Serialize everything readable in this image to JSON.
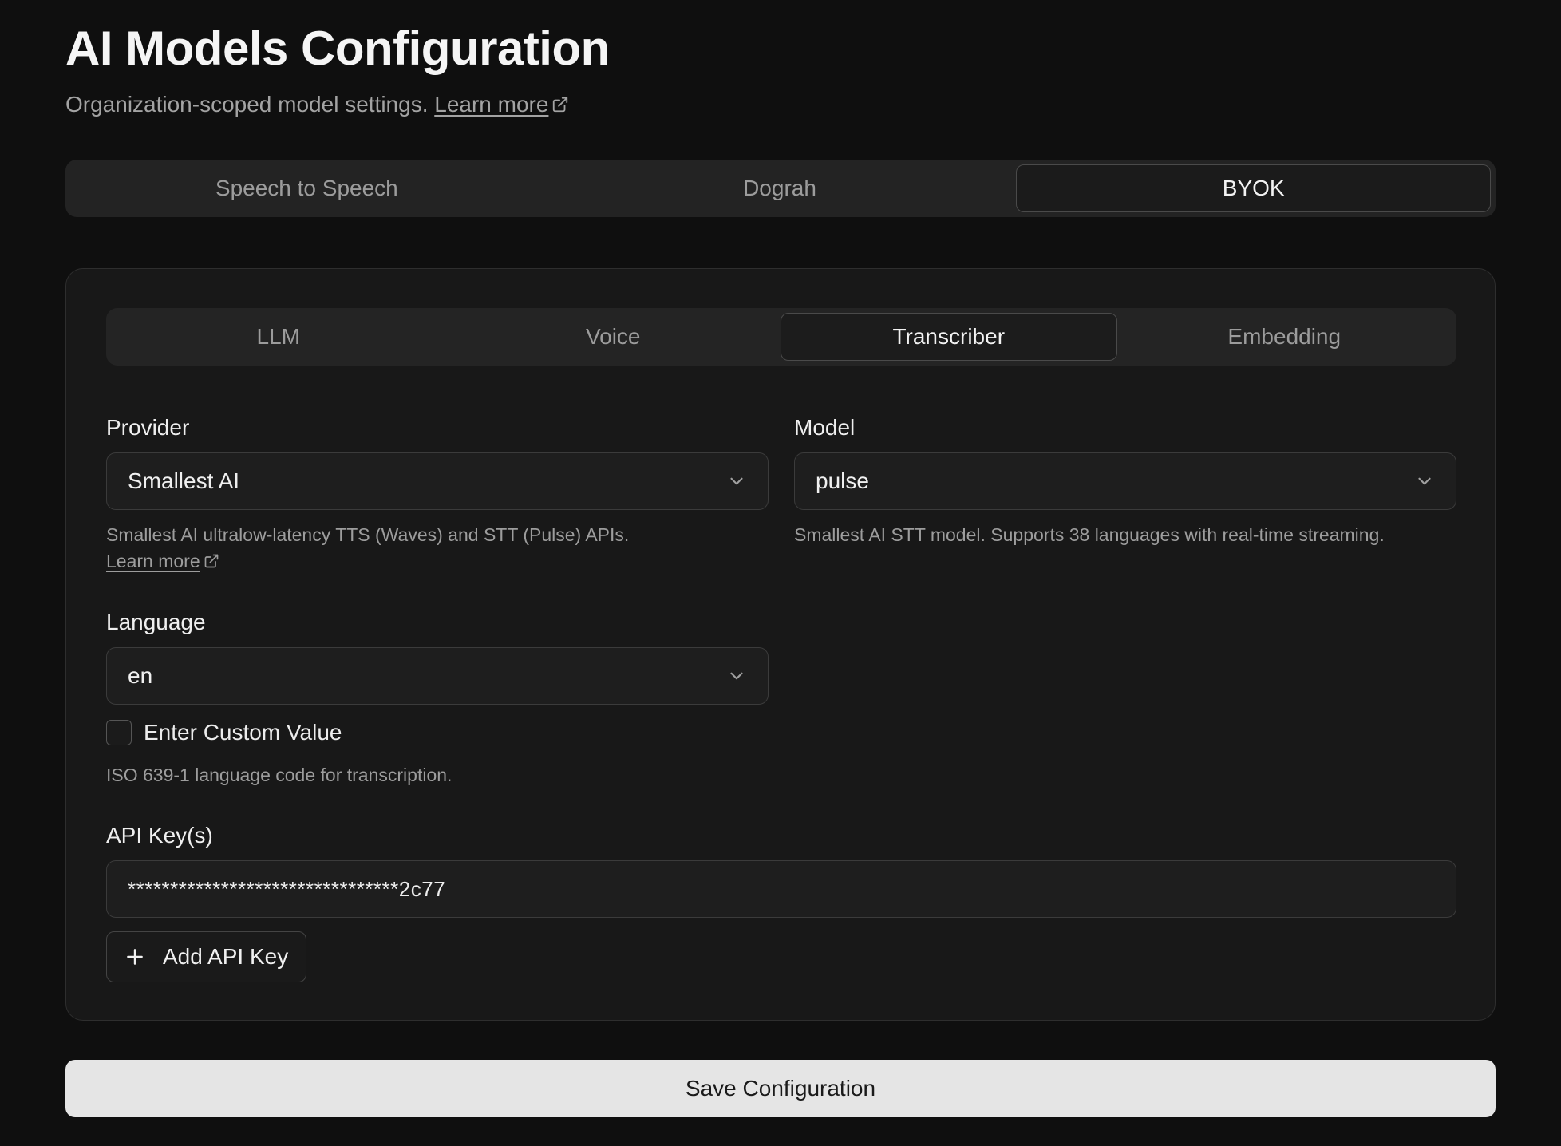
{
  "header": {
    "title": "AI Models Configuration",
    "subtitle": "Organization-scoped model settings.",
    "learn_more": "Learn more"
  },
  "top_tabs": [
    {
      "label": "Speech to Speech",
      "active": false
    },
    {
      "label": "Dograh",
      "active": false
    },
    {
      "label": "BYOK",
      "active": true
    }
  ],
  "inner_tabs": [
    {
      "label": "LLM",
      "active": false
    },
    {
      "label": "Voice",
      "active": false
    },
    {
      "label": "Transcriber",
      "active": true
    },
    {
      "label": "Embedding",
      "active": false
    }
  ],
  "provider": {
    "label": "Provider",
    "value": "Smallest AI",
    "help": "Smallest AI ultralow-latency TTS (Waves) and STT (Pulse) APIs.",
    "learn_more": "Learn more"
  },
  "model": {
    "label": "Model",
    "value": "pulse",
    "help": "Smallest AI STT model. Supports 38 languages with real-time streaming."
  },
  "language": {
    "label": "Language",
    "value": "en",
    "custom_checkbox_label": "Enter Custom Value",
    "custom_checked": false,
    "help": "ISO 639-1 language code for transcription."
  },
  "api_keys": {
    "label": "API Key(s)",
    "value": "********************************2c77",
    "add_label": "Add API Key"
  },
  "save_label": "Save Configuration",
  "icons": {
    "external_link": "external-link-icon",
    "chevron": "chevron-down-icon",
    "plus": "plus-icon"
  }
}
